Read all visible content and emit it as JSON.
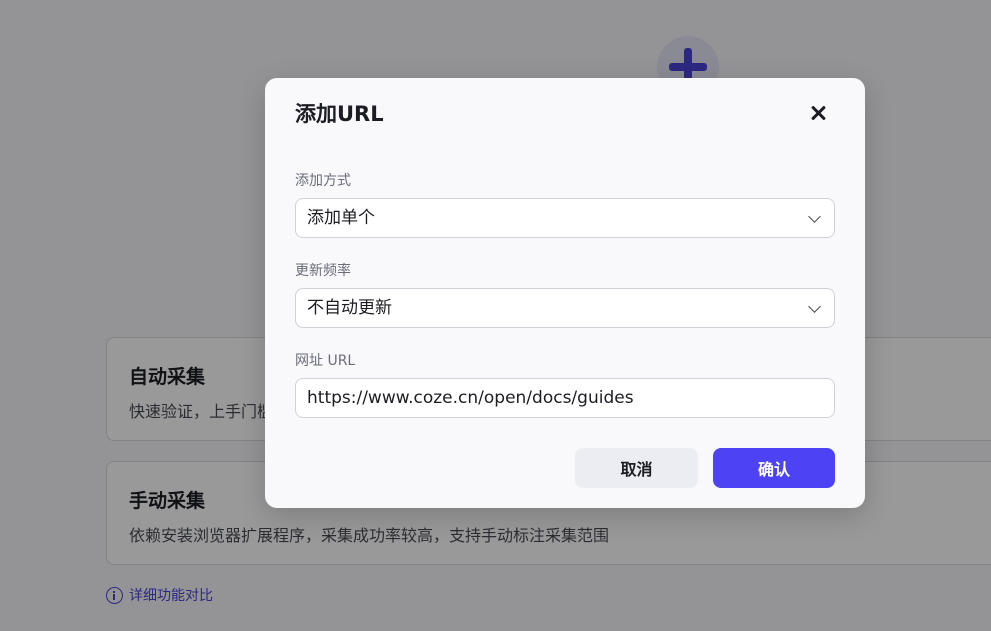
{
  "background": {
    "cards": [
      {
        "title": "自动采集",
        "description": "快速验证，上手门槛低"
      },
      {
        "title": "手动采集",
        "description": "依赖安装浏览器扩展程序，采集成功率较高，支持手动标注采集范围"
      }
    ],
    "compare_link": "详细功能对比",
    "compare_icon": "info-icon"
  },
  "modal": {
    "title": "添加URL",
    "close_icon": "close-icon",
    "fields": {
      "mode": {
        "label": "添加方式",
        "value": "添加单个"
      },
      "frequency": {
        "label": "更新频率",
        "value": "不自动更新"
      },
      "url": {
        "label": "网址 URL",
        "value": "https://www.coze.cn/open/docs/guides"
      }
    },
    "cancel_label": "取消",
    "confirm_label": "确认"
  },
  "colors": {
    "accent": "#4d43f4",
    "link": "#4b44d7",
    "overlay": "rgba(0,0,0,0.40)"
  }
}
